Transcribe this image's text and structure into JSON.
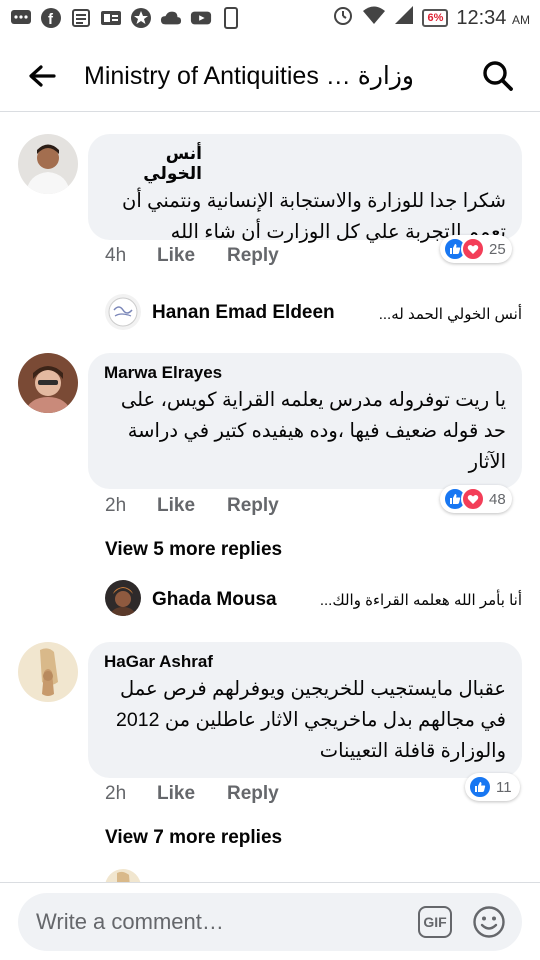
{
  "status_bar": {
    "battery": "6%",
    "time": "12:34",
    "ampm": "AM"
  },
  "header": {
    "title": "Ministry of Antiquities … وزارة"
  },
  "comments": [
    {
      "author": "أنس الخولي",
      "text": "شكرا جدا للوزارة والاستجابة الإنسانية ونتمني أن تعمم التجربة علي كل الوزارت أن شاء الله",
      "time": "4h",
      "like": "Like",
      "reply": "Reply",
      "reactions": "25"
    },
    {
      "author": "Marwa Elrayes",
      "text": "يا ريت توفروله مدرس يعلمه القراية كويس، على حد قوله ضعيف فيها ،وده هيفيده كتير في دراسة الآثار",
      "time": "2h",
      "like": "Like",
      "reply": "Reply",
      "reactions": "48"
    },
    {
      "author": "HaGar Ashraf",
      "text": "عقبال مايستجيب للخريجين ويوفرلهم فرص عمل في مجالهم بدل ماخريجي الاثار عاطلين من 2012 والوزارة قافلة التعيينات",
      "time": "2h",
      "like": "Like",
      "reply": "Reply",
      "reactions": "11"
    }
  ],
  "replies": [
    {
      "name": "Hanan Emad Eldeen",
      "snippet": "أنس الخولي الحمد له..."
    },
    {
      "name": "Ghada Mousa",
      "snippet": "أنا بأمر الله  هعلمه القراءة والك..."
    }
  ],
  "view_more": [
    "View 5 more replies",
    "View 7 more replies"
  ],
  "footer": {
    "placeholder": "Write a comment…",
    "gif": "GIF"
  },
  "colors": {
    "bubble": "#f0f2f5",
    "like_blue": "#1877f2",
    "love_red": "#f33e58",
    "secondary_text": "#65676b"
  }
}
